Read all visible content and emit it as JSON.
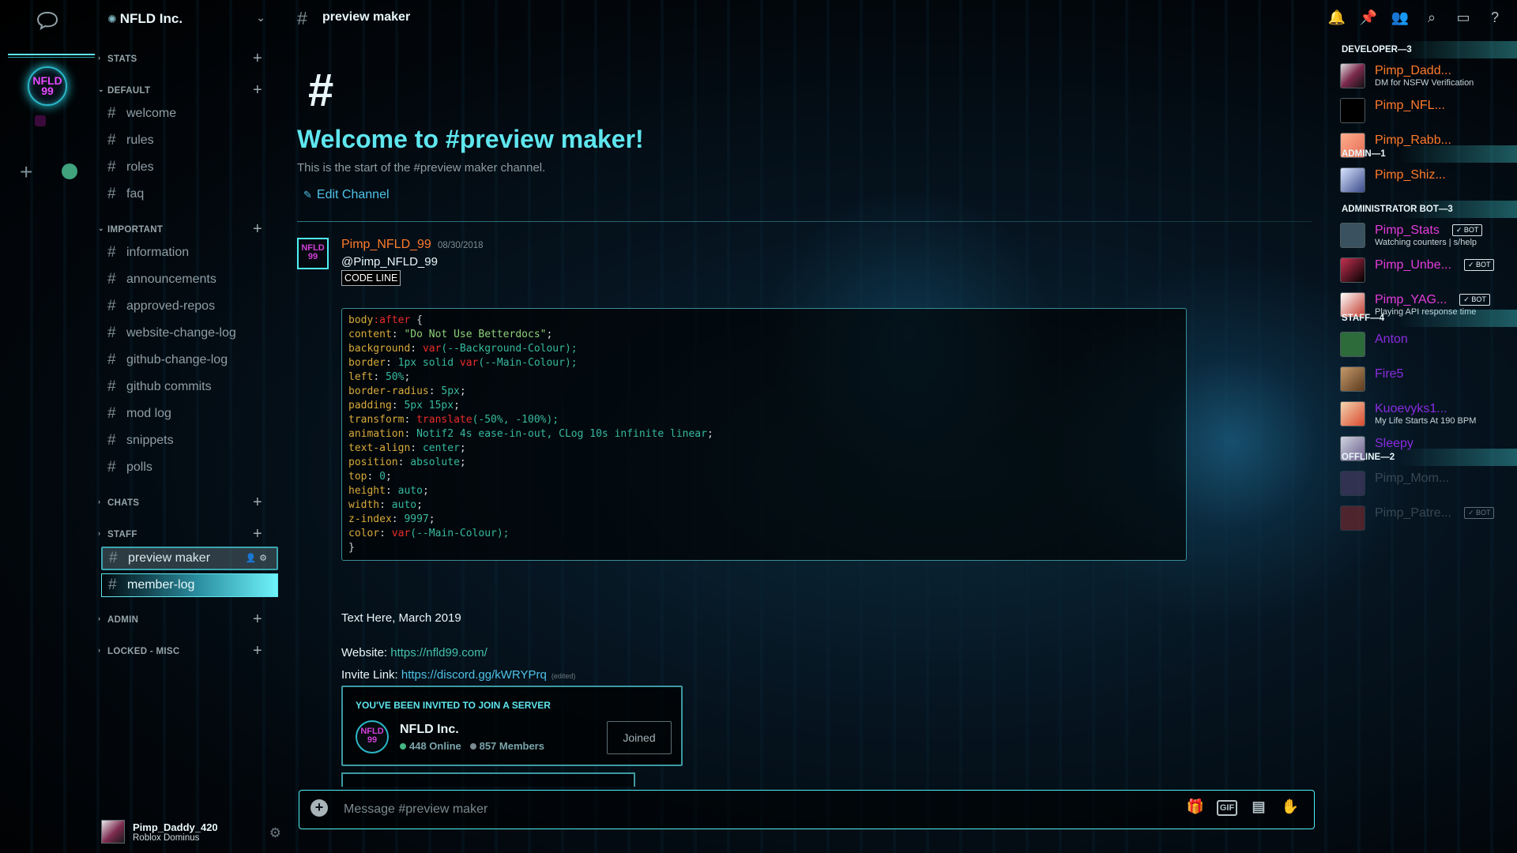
{
  "colors": {
    "accent": "#5fe6ee",
    "developer_name": "#ff7a2a",
    "bot_name": "#e63bdc",
    "staff_name": "#8a2be2",
    "online": "#43b581",
    "members_total": "#7a8a90"
  },
  "server": {
    "name": "NFLD Inc.",
    "icon_text": "NFLD 99"
  },
  "rail": {
    "dm_icon": "chat-bubble-icon",
    "add_icon": "plus-icon",
    "explore_icon": "compass-icon"
  },
  "sidebar": {
    "categories": [
      {
        "label": "STATS",
        "channels": []
      },
      {
        "label": "DEFAULT",
        "channels": [
          "welcome",
          "rules",
          "roles",
          "faq"
        ]
      },
      {
        "label": "IMPORTANT",
        "channels": [
          "information",
          "announcements",
          "approved-repos",
          "website-change-log",
          "github-change-log",
          "github commits",
          "mod log",
          "snippets",
          "polls"
        ]
      },
      {
        "label": "CHATS",
        "channels": []
      },
      {
        "label": "STAFF",
        "channels": [
          "preview maker",
          "member-log"
        ]
      },
      {
        "label": "ADMIN",
        "channels": []
      },
      {
        "label": "LOCKED - MISC",
        "channels": []
      }
    ]
  },
  "user": {
    "name": "Pimp_Daddy_420",
    "status": "Roblox Dominus"
  },
  "channel": {
    "name": "preview maker",
    "welcome_title": "Welcome to #preview maker!",
    "welcome_sub": "This is the start of the #preview maker channel.",
    "edit_label": "Edit Channel"
  },
  "message": {
    "author": "Pimp_NFLD_99",
    "timestamp": "08/30/2018",
    "mention": "@Pimp_NFLD_99",
    "code_label": "CODE LINE",
    "avatar_text": "NFLD 99",
    "code": [
      [
        {
          "t": "body",
          "c": "p"
        },
        {
          "t": ":after",
          "c": "f"
        },
        {
          "t": " {",
          "c": "x"
        }
      ],
      [
        {
          "t": "content",
          "c": "p"
        },
        {
          "t": ": ",
          "c": "x"
        },
        {
          "t": "\"Do Not Use Betterdocs\"",
          "c": "s"
        },
        {
          "t": ";",
          "c": "x"
        }
      ],
      [
        {
          "t": "background",
          "c": "p"
        },
        {
          "t": ": ",
          "c": "x"
        },
        {
          "t": "var",
          "c": "f"
        },
        {
          "t": "(--Background-Colour);",
          "c": "v"
        }
      ],
      [
        {
          "t": "border",
          "c": "p"
        },
        {
          "t": ": ",
          "c": "x"
        },
        {
          "t": "1px solid ",
          "c": "v"
        },
        {
          "t": "var",
          "c": "f"
        },
        {
          "t": "(--Main-Colour);",
          "c": "v"
        }
      ],
      [
        {
          "t": "left",
          "c": "p"
        },
        {
          "t": ": ",
          "c": "x"
        },
        {
          "t": "50%",
          "c": "v"
        },
        {
          "t": ";",
          "c": "x"
        }
      ],
      [
        {
          "t": "border-radius",
          "c": "p"
        },
        {
          "t": ": ",
          "c": "x"
        },
        {
          "t": "5px",
          "c": "v"
        },
        {
          "t": ";",
          "c": "x"
        }
      ],
      [
        {
          "t": "padding",
          "c": "p"
        },
        {
          "t": ": ",
          "c": "x"
        },
        {
          "t": "5px 15px",
          "c": "v"
        },
        {
          "t": ";",
          "c": "x"
        }
      ],
      [
        {
          "t": "transform",
          "c": "p"
        },
        {
          "t": ": ",
          "c": "x"
        },
        {
          "t": "translate",
          "c": "f"
        },
        {
          "t": "(-50%, -100%);",
          "c": "v"
        }
      ],
      [
        {
          "t": "animation",
          "c": "p"
        },
        {
          "t": ": ",
          "c": "x"
        },
        {
          "t": "Notif2 4s ease-in-out, CLog 10s infinite linear",
          "c": "v"
        },
        {
          "t": ";",
          "c": "x"
        }
      ],
      [
        {
          "t": "text-align",
          "c": "p"
        },
        {
          "t": ": ",
          "c": "x"
        },
        {
          "t": "center",
          "c": "v"
        },
        {
          "t": ";",
          "c": "x"
        }
      ],
      [
        {
          "t": "position",
          "c": "p"
        },
        {
          "t": ": ",
          "c": "x"
        },
        {
          "t": "absolute",
          "c": "v"
        },
        {
          "t": ";",
          "c": "x"
        }
      ],
      [
        {
          "t": "top",
          "c": "p"
        },
        {
          "t": ": ",
          "c": "x"
        },
        {
          "t": "0",
          "c": "v"
        },
        {
          "t": ";",
          "c": "x"
        }
      ],
      [
        {
          "t": "height",
          "c": "p"
        },
        {
          "t": ": ",
          "c": "x"
        },
        {
          "t": "auto",
          "c": "v"
        },
        {
          "t": ";",
          "c": "x"
        }
      ],
      [
        {
          "t": "width",
          "c": "p"
        },
        {
          "t": ": ",
          "c": "x"
        },
        {
          "t": "auto",
          "c": "v"
        },
        {
          "t": ";",
          "c": "x"
        }
      ],
      [
        {
          "t": "z-index",
          "c": "p"
        },
        {
          "t": ": ",
          "c": "x"
        },
        {
          "t": "9997",
          "c": "v"
        },
        {
          "t": ";",
          "c": "x"
        }
      ],
      [
        {
          "t": "color",
          "c": "p"
        },
        {
          "t": ": ",
          "c": "x"
        },
        {
          "t": "var",
          "c": "f"
        },
        {
          "t": "(--Main-Colour);",
          "c": "v"
        }
      ],
      [
        {
          "t": "}",
          "c": "x"
        }
      ]
    ],
    "text_here": "Text Here, March 2019",
    "website_label": "Website: ",
    "website_url": "https://nfld99.com/",
    "invite_label": "Invite Link: ",
    "invite_url": "https://discord.gg/kWRYPrq",
    "edited": "(edited)"
  },
  "invite": {
    "header": "YOU'VE BEEN INVITED TO JOIN A SERVER",
    "name": "NFLD Inc.",
    "online": "448 Online",
    "members": "857 Members",
    "button": "Joined"
  },
  "composer": {
    "placeholder": "Message #preview maker",
    "icons": [
      "gift-icon",
      "gif-icon",
      "sticker-icon",
      "emoji-icon"
    ],
    "gif_label": "GIF"
  },
  "topbar": {
    "icons": [
      "bell-icon",
      "pin-icon",
      "members-icon",
      "search-icon",
      "inbox-icon",
      "help-icon"
    ]
  },
  "members": {
    "groups": [
      {
        "label": "DEVELOPER—3",
        "items": [
          {
            "name": "Pimp_Dadd...",
            "activity": "DM for NSFW Verification",
            "bot": false
          },
          {
            "name": "Pimp_NFL...",
            "activity": "",
            "bot": false
          },
          {
            "name": "Pimp_Rabb...",
            "activity": "",
            "bot": false
          }
        ]
      },
      {
        "label": "ADMIN—1",
        "items": [
          {
            "name": "Pimp_Shiz...",
            "activity": "",
            "bot": false
          }
        ]
      },
      {
        "label": "ADMINISTRATOR BOT—3",
        "items": [
          {
            "name": "Pimp_Stats",
            "activity": "Watching counters | s/help",
            "bot": true
          },
          {
            "name": "Pimp_Unbe...",
            "activity": "",
            "bot": true
          },
          {
            "name": "Pimp_YAG...",
            "activity": "Playing API response time",
            "bot": true
          }
        ]
      },
      {
        "label": "STAFF—4",
        "items": [
          {
            "name": "Anton",
            "activity": "",
            "bot": false
          },
          {
            "name": "Fire5",
            "activity": "",
            "bot": false
          },
          {
            "name": "Kuoevyks1...",
            "activity": "My Life Starts At 190 BPM",
            "bot": false
          },
          {
            "name": "Sleepy",
            "activity": "",
            "bot": false
          }
        ]
      },
      {
        "label": "OFFLINE—2",
        "items": [
          {
            "name": "Pimp_Mom...",
            "activity": "",
            "bot": false
          },
          {
            "name": "Pimp_Patre...",
            "activity": "",
            "bot": true
          }
        ]
      }
    ],
    "bot_label": "✓ BOT"
  }
}
